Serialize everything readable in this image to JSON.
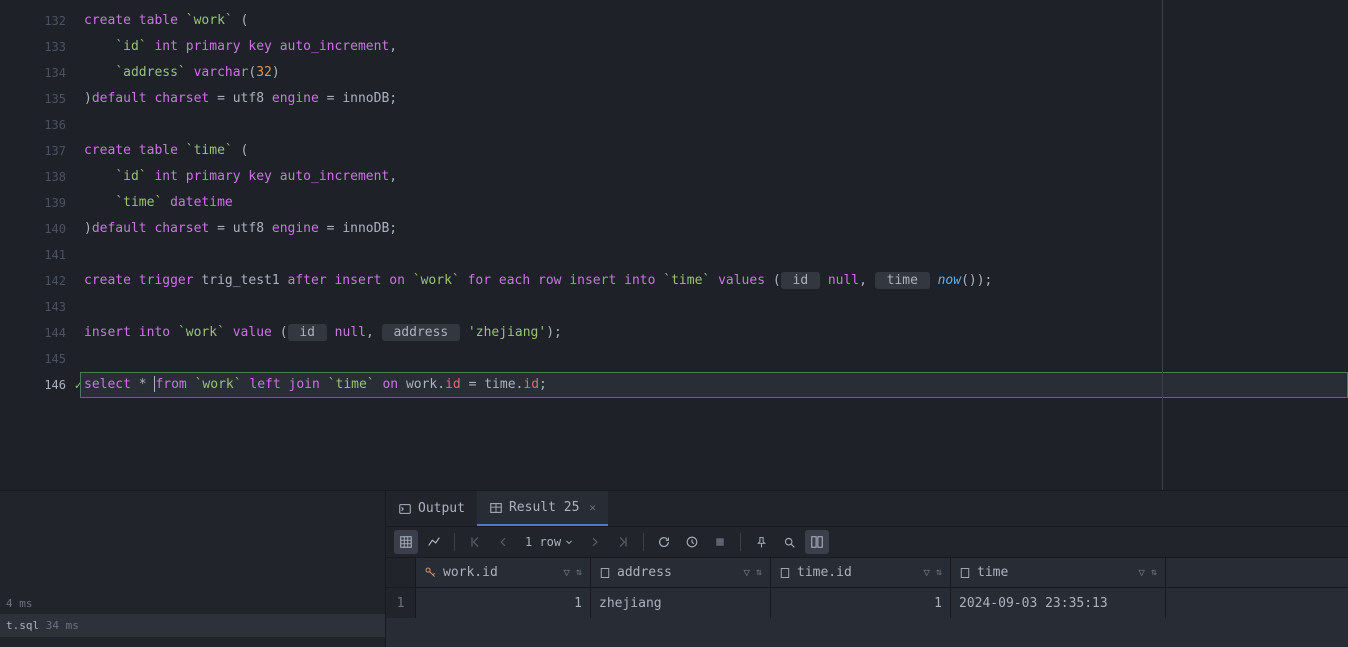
{
  "editor": {
    "lines": [
      {
        "num": 132,
        "tokens": [
          {
            "t": "create",
            "c": "kw"
          },
          {
            "t": " "
          },
          {
            "t": "table",
            "c": "kw"
          },
          {
            "t": " "
          },
          {
            "t": "`work`",
            "c": "str"
          },
          {
            "t": " ("
          }
        ]
      },
      {
        "num": 133,
        "tokens": [
          {
            "t": "    "
          },
          {
            "t": "`id`",
            "c": "str"
          },
          {
            "t": " "
          },
          {
            "t": "int",
            "c": "kw"
          },
          {
            "t": " "
          },
          {
            "t": "primary key",
            "c": "kw"
          },
          {
            "t": " "
          },
          {
            "t": "auto_increment",
            "c": "kw"
          },
          {
            "t": ","
          }
        ]
      },
      {
        "num": 134,
        "tokens": [
          {
            "t": "    "
          },
          {
            "t": "`address`",
            "c": "str"
          },
          {
            "t": " "
          },
          {
            "t": "varchar",
            "c": "kw"
          },
          {
            "t": "("
          },
          {
            "t": "32",
            "c": "num"
          },
          {
            "t": ")"
          }
        ]
      },
      {
        "num": 135,
        "tokens": [
          {
            "t": ")"
          },
          {
            "t": "default",
            "c": "kw"
          },
          {
            "t": " "
          },
          {
            "t": "charset",
            "c": "kw"
          },
          {
            "t": " = utf8 "
          },
          {
            "t": "engine",
            "c": "kw"
          },
          {
            "t": " = innoDB;"
          }
        ]
      },
      {
        "num": 136,
        "tokens": []
      },
      {
        "num": 137,
        "tokens": [
          {
            "t": "create",
            "c": "kw"
          },
          {
            "t": " "
          },
          {
            "t": "table",
            "c": "kw"
          },
          {
            "t": " "
          },
          {
            "t": "`time`",
            "c": "str"
          },
          {
            "t": " ("
          }
        ]
      },
      {
        "num": 138,
        "tokens": [
          {
            "t": "    "
          },
          {
            "t": "`id`",
            "c": "str"
          },
          {
            "t": " "
          },
          {
            "t": "int",
            "c": "kw"
          },
          {
            "t": " "
          },
          {
            "t": "primary key",
            "c": "kw"
          },
          {
            "t": " "
          },
          {
            "t": "auto_increment",
            "c": "kw"
          },
          {
            "t": ","
          }
        ]
      },
      {
        "num": 139,
        "tokens": [
          {
            "t": "    "
          },
          {
            "t": "`time`",
            "c": "str"
          },
          {
            "t": " "
          },
          {
            "t": "datetime",
            "c": "kw"
          }
        ]
      },
      {
        "num": 140,
        "tokens": [
          {
            "t": ")"
          },
          {
            "t": "default",
            "c": "kw"
          },
          {
            "t": " "
          },
          {
            "t": "charset",
            "c": "kw"
          },
          {
            "t": " = utf8 "
          },
          {
            "t": "engine",
            "c": "kw"
          },
          {
            "t": " = innoDB;"
          }
        ]
      },
      {
        "num": 141,
        "tokens": []
      },
      {
        "num": 142,
        "tokens": [
          {
            "t": "create",
            "c": "kw"
          },
          {
            "t": " "
          },
          {
            "t": "trigger",
            "c": "kw"
          },
          {
            "t": " trig_test1 "
          },
          {
            "t": "after",
            "c": "kw"
          },
          {
            "t": " "
          },
          {
            "t": "insert",
            "c": "kw"
          },
          {
            "t": " "
          },
          {
            "t": "on",
            "c": "kw"
          },
          {
            "t": " "
          },
          {
            "t": "`work`",
            "c": "str"
          },
          {
            "t": " "
          },
          {
            "t": "for",
            "c": "kw"
          },
          {
            "t": " "
          },
          {
            "t": "each",
            "c": "kw"
          },
          {
            "t": " "
          },
          {
            "t": "row",
            "c": "kw"
          },
          {
            "t": " "
          },
          {
            "t": "insert",
            "c": "kw"
          },
          {
            "t": " "
          },
          {
            "t": "into",
            "c": "kw"
          },
          {
            "t": " "
          },
          {
            "t": "`time`",
            "c": "str"
          },
          {
            "t": " "
          },
          {
            "t": "values",
            "c": "kw"
          },
          {
            "t": " ("
          },
          {
            "t": " id ",
            "c": "id-bg"
          },
          {
            "t": " "
          },
          {
            "t": "null",
            "c": "kw"
          },
          {
            "t": ", "
          },
          {
            "t": " time ",
            "c": "id-bg"
          },
          {
            "t": " "
          },
          {
            "t": "now",
            "c": "fn"
          },
          {
            "t": "());"
          }
        ]
      },
      {
        "num": 143,
        "tokens": []
      },
      {
        "num": 144,
        "tokens": [
          {
            "t": "insert",
            "c": "kw"
          },
          {
            "t": " "
          },
          {
            "t": "into",
            "c": "kw"
          },
          {
            "t": " "
          },
          {
            "t": "`work`",
            "c": "str"
          },
          {
            "t": " "
          },
          {
            "t": "value",
            "c": "kw"
          },
          {
            "t": " ("
          },
          {
            "t": " id ",
            "c": "id-bg"
          },
          {
            "t": " "
          },
          {
            "t": "null",
            "c": "kw"
          },
          {
            "t": ", "
          },
          {
            "t": " address ",
            "c": "id-bg"
          },
          {
            "t": " "
          },
          {
            "t": "'zhejiang'",
            "c": "str"
          },
          {
            "t": ");"
          }
        ]
      },
      {
        "num": 145,
        "tokens": []
      },
      {
        "num": 146,
        "active": true,
        "check": true,
        "boxed": true,
        "tokens": [
          {
            "t": "select",
            "c": "kw"
          },
          {
            "t": " * "
          },
          {
            "cursor": true
          },
          {
            "t": "from",
            "c": "kw"
          },
          {
            "t": " "
          },
          {
            "t": "`work`",
            "c": "str"
          },
          {
            "t": " "
          },
          {
            "t": "left join",
            "c": "kw"
          },
          {
            "t": " "
          },
          {
            "t": "`time`",
            "c": "str"
          },
          {
            "t": " "
          },
          {
            "t": "on",
            "c": "kw"
          },
          {
            "t": " "
          },
          {
            "t": "work",
            "c": ""
          },
          {
            "t": "."
          },
          {
            "t": "id",
            "c": "col"
          },
          {
            "t": " = "
          },
          {
            "t": "time",
            "c": ""
          },
          {
            "t": "."
          },
          {
            "t": "id",
            "c": "col"
          },
          {
            "t": ";"
          }
        ]
      }
    ]
  },
  "left_panel": {
    "timing": "4 ms",
    "file": "t.sql",
    "file_time": "34 ms"
  },
  "tabs": {
    "output": "Output",
    "result": "Result 25"
  },
  "toolbar": {
    "row_count": "1 row"
  },
  "grid": {
    "columns": [
      {
        "icon": "pk",
        "name": "work.id"
      },
      {
        "icon": "col",
        "name": "address"
      },
      {
        "icon": "col",
        "name": "time.id"
      },
      {
        "icon": "col",
        "name": "time"
      }
    ],
    "rows": [
      {
        "n": 1,
        "work_id": "1",
        "address": "zhejiang",
        "time_id": "1",
        "time": "2024-09-03 23:35:13"
      }
    ]
  }
}
